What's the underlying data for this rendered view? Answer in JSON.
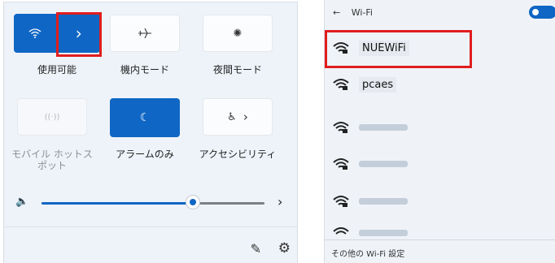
{
  "quick_settings": {
    "tiles": [
      {
        "id": "wifi",
        "label": "使用可能",
        "icon": "wifi-icon",
        "arrow": "›",
        "state": "on"
      },
      {
        "id": "airplane",
        "label": "機内モード",
        "icon": "airplane-icon",
        "state": "off"
      },
      {
        "id": "night",
        "label": "夜間モード",
        "icon": "brightness-icon",
        "state": "off"
      },
      {
        "id": "hotspot",
        "label": "モバイル ホットスポット",
        "icon": "hotspot-icon",
        "state": "disabled"
      },
      {
        "id": "alarms",
        "label": "アラームのみ",
        "icon": "moon-icon",
        "state": "on"
      },
      {
        "id": "accessibility",
        "label": "アクセシビリティ",
        "icon": "accessibility-icon",
        "arrow": "›",
        "state": "off"
      }
    ],
    "volume": {
      "level": 0.68,
      "arrow": "›"
    }
  },
  "wifi_panel": {
    "back": "←",
    "title": "Wi-Fi",
    "networks": [
      {
        "name": "NUEWiFi",
        "highlighted": true
      },
      {
        "name": "pcaes",
        "highlighted": false
      },
      {
        "name": "",
        "highlighted": false
      },
      {
        "name": "",
        "highlighted": false
      },
      {
        "name": "",
        "highlighted": false
      },
      {
        "name": "",
        "highlighted": false
      }
    ],
    "footer": "その他の Wi-Fi 設定"
  },
  "colors": {
    "accent": "#0f66c4",
    "highlight": "#e11d1d"
  }
}
